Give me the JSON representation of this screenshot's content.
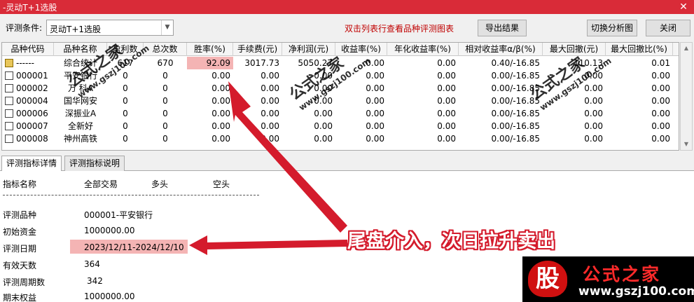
{
  "window": {
    "title": "-灵动T+1选股",
    "close": "✕"
  },
  "toolbar": {
    "condition_label": "评测条件:",
    "condition_value": "灵动T+1选股",
    "hint": "双击列表行查看品种评测图表",
    "export_label": "导出结果",
    "switch_label": "切换分析图",
    "close_label": "关闭"
  },
  "table": {
    "columns": [
      "品种代码",
      "品种名称",
      "盈利数",
      "总次数",
      "胜率(%)",
      "手续费(元)",
      "净利润(元)",
      "收益率(%)",
      "年化收益率(%)",
      "相对收益率α/β(%)",
      "最大回撤(元)",
      "最大回撤比(%)"
    ],
    "rows": [
      [
        "------",
        "综合统计",
        "617",
        "670",
        "92.09",
        "3017.73",
        "5050.27",
        "0.00",
        "0.00",
        "0.40/-16.85",
        "110.13",
        "0.01"
      ],
      [
        "000001",
        "平安银行",
        "0",
        "0",
        "0.00",
        "0.00",
        "0.00",
        "0.00",
        "0.00",
        "0.00/-16.85",
        "0.00",
        "0.00"
      ],
      [
        "000002",
        "万 科A",
        "0",
        "0",
        "0.00",
        "0.00",
        "0.00",
        "0.00",
        "0.00",
        "0.00/-16.85",
        "0.00",
        "0.00"
      ],
      [
        "000004",
        "国华网安",
        "0",
        "0",
        "0.00",
        "0.00",
        "0.00",
        "0.00",
        "0.00",
        "0.00/-16.85",
        "0.00",
        "0.00"
      ],
      [
        "000006",
        "深振业A",
        "0",
        "0",
        "0.00",
        "0.00",
        "0.00",
        "0.00",
        "0.00",
        "0.00/-16.85",
        "0.00",
        "0.00"
      ],
      [
        "000007",
        "全新好",
        "0",
        "0",
        "0.00",
        "0.00",
        "0.00",
        "0.00",
        "0.00",
        "0.00/-16.85",
        "0.00",
        "0.00"
      ],
      [
        "000008",
        "神州高铁",
        "0",
        "0",
        "0.00",
        "0.00",
        "0.00",
        "0.00",
        "0.00",
        "0.00/-16.85",
        "0.00",
        "0.00"
      ]
    ]
  },
  "tabs": [
    "评测指标详情",
    "评测指标说明"
  ],
  "detail": {
    "headers": [
      "指标名称",
      "全部交易",
      "多头",
      "空头"
    ],
    "items": [
      {
        "label": "评测品种",
        "value": "000001-平安银行"
      },
      {
        "label": "初始资金",
        "value": "1000000.00"
      },
      {
        "label": "评测日期",
        "value": "2023/12/11-2024/12/10"
      },
      {
        "label": "有效天数",
        "value": "364"
      },
      {
        "label": "评测周期数",
        "value": "342"
      },
      {
        "label": "期末权益",
        "value": "1000000.00"
      }
    ]
  },
  "annotation": {
    "callout": "尾盘介入，次日拉升卖出",
    "color": "#d41b2c",
    "highlight": "#f4b4b4"
  },
  "watermark": {
    "text": "公式之家",
    "url": "www.gszj100.com"
  },
  "logo": {
    "glyph": "股",
    "name": "公式之家",
    "url": "www.gszj100.com"
  }
}
